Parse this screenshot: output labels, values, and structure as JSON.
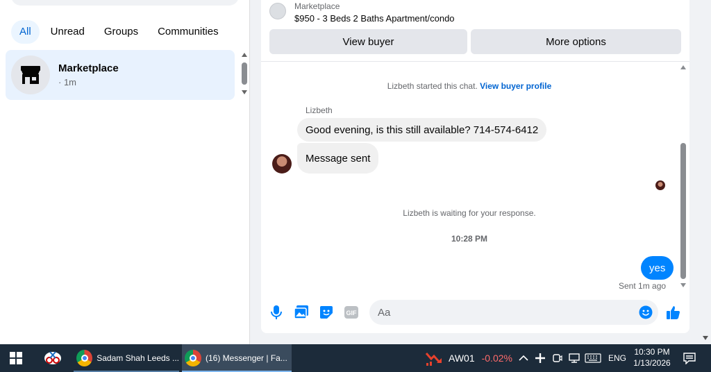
{
  "sidebar": {
    "filters": [
      "All",
      "Unread",
      "Groups",
      "Communities"
    ],
    "active_filter": "All",
    "chat": {
      "name": "Marketplace",
      "time": "· 1m"
    }
  },
  "conversation": {
    "source": "Marketplace",
    "listing": "$950 - 3 Beds 2 Baths Apartment/condo",
    "view_buyer": "View buyer",
    "more_options": "More options",
    "started_text": "Lizbeth started this chat.",
    "profile_link": "View buyer profile",
    "sender": "Lizbeth",
    "messages_in": [
      "Good evening, is this still available? 714-574-6412",
      "Message sent"
    ],
    "waiting_text": "Lizbeth is waiting for your response.",
    "timestamp": "10:28 PM",
    "message_out": "yes",
    "sent_status": "Sent 1m ago",
    "composer_placeholder": "Aa",
    "colors": {
      "accent": "#0084ff",
      "link": "#0064d1"
    }
  },
  "taskbar": {
    "apps": [
      {
        "label": "Sadam Shah Leeds ...",
        "active": false
      },
      {
        "label": "(16) Messenger | Fa...",
        "active": true
      }
    ],
    "ticker": {
      "symbol": "AW01",
      "change": "-0.02%"
    },
    "language": "ENG",
    "time": "10:30 PM",
    "date": "1/13/2026"
  }
}
